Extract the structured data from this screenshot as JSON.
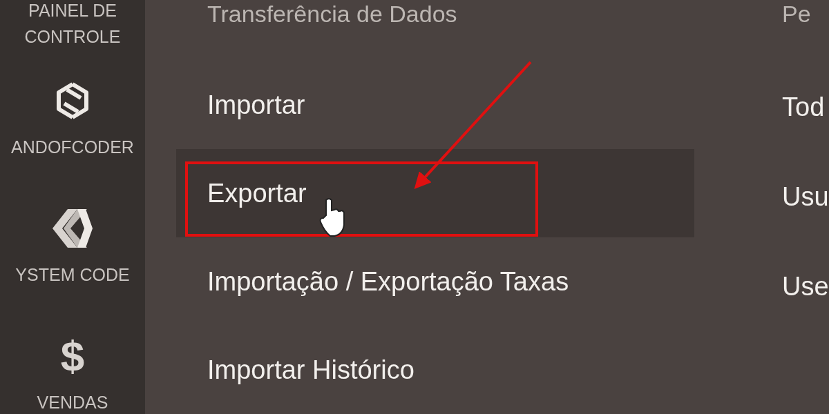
{
  "sidebar": {
    "items": [
      {
        "kind": "text",
        "label": "PAINEL DE CONTROLE"
      },
      {
        "kind": "knot",
        "label": "ANDOFCODER"
      },
      {
        "kind": "chevron",
        "label": "YSTEM CODE"
      },
      {
        "kind": "glyph",
        "icon": "$",
        "label": "VENDAS"
      }
    ]
  },
  "columns": [
    {
      "heading": "Transferência de Dados",
      "items": [
        {
          "label": "Importar",
          "selected": false
        },
        {
          "label": "Exportar",
          "selected": true
        },
        {
          "label": "Importação / Exportação Taxas",
          "selected": false
        },
        {
          "label": "Importar Histórico",
          "selected": false
        }
      ]
    },
    {
      "heading": "Pe",
      "items": [
        {
          "label": "Tod",
          "selected": false
        },
        {
          "label": "Usu",
          "selected": false
        },
        {
          "label": "Use",
          "selected": false
        }
      ]
    }
  ]
}
